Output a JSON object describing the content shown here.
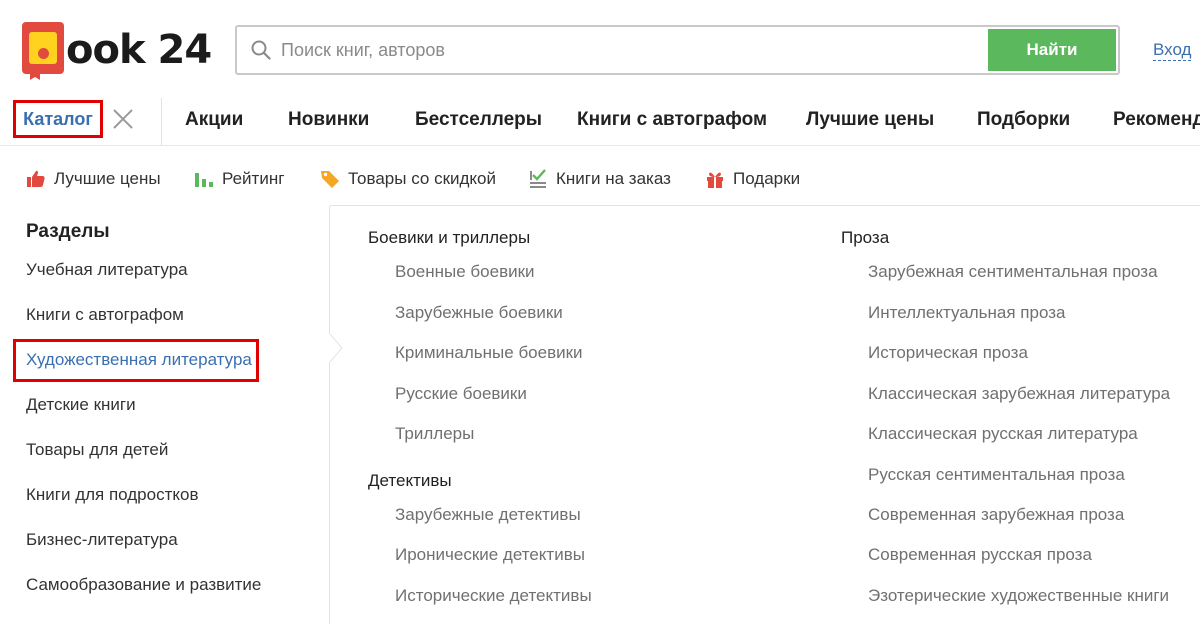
{
  "logo": {
    "text": "ook 24",
    "brand_red": "#e24a3f",
    "brand_yellow": "#ffd21f"
  },
  "search": {
    "placeholder": "Поиск книг, авторов",
    "value": "",
    "button_label": "Найти",
    "button_color": "#5cb85c"
  },
  "login_label": "Вход",
  "nav": {
    "catalog_label": "Каталог",
    "items": [
      "Акции",
      "Новинки",
      "Бестселлеры",
      "Книги с автографом",
      "Лучшие цены",
      "Подборки",
      "Рекомендации"
    ]
  },
  "subnav": [
    {
      "label": "Лучшие цены",
      "icon": "thumbs-up-icon"
    },
    {
      "label": "Рейтинг",
      "icon": "rating-bars-icon"
    },
    {
      "label": "Товары со скидкой",
      "icon": "tag-icon"
    },
    {
      "label": "Книги на заказ",
      "icon": "checklist-icon"
    },
    {
      "label": "Подарки",
      "icon": "gift-icon"
    }
  ],
  "sections": {
    "title": "Разделы",
    "items": [
      "Учебная литература",
      "Книги с автографом",
      "Художественная литература",
      "Детские книги",
      "Товары для детей",
      "Книги для подростков",
      "Бизнес-литература",
      "Самообразование и развитие"
    ],
    "active_index": 2
  },
  "columns": [
    {
      "groups": [
        {
          "title": "Боевики и триллеры",
          "items": [
            "Военные боевики",
            "Зарубежные боевики",
            "Криминальные боевики",
            "Русские боевики",
            "Триллеры"
          ]
        },
        {
          "title": "Детективы",
          "items": [
            "Зарубежные детективы",
            "Иронические детективы",
            "Исторические детективы"
          ]
        }
      ]
    },
    {
      "groups": [
        {
          "title": "Проза",
          "items": [
            "Зарубежная сентиментальная проза",
            "Интеллектуальная проза",
            "Историческая проза",
            "Классическая зарубежная литература",
            "Классическая русская литература",
            "Русская сентиментальная проза",
            "Современная зарубежная проза",
            "Современная русская проза",
            "Эзотерические художественные книги"
          ]
        }
      ]
    }
  ],
  "colors": {
    "link_blue": "#3a6fb0",
    "highlight_red": "#e00000",
    "muted_text": "#707070"
  }
}
